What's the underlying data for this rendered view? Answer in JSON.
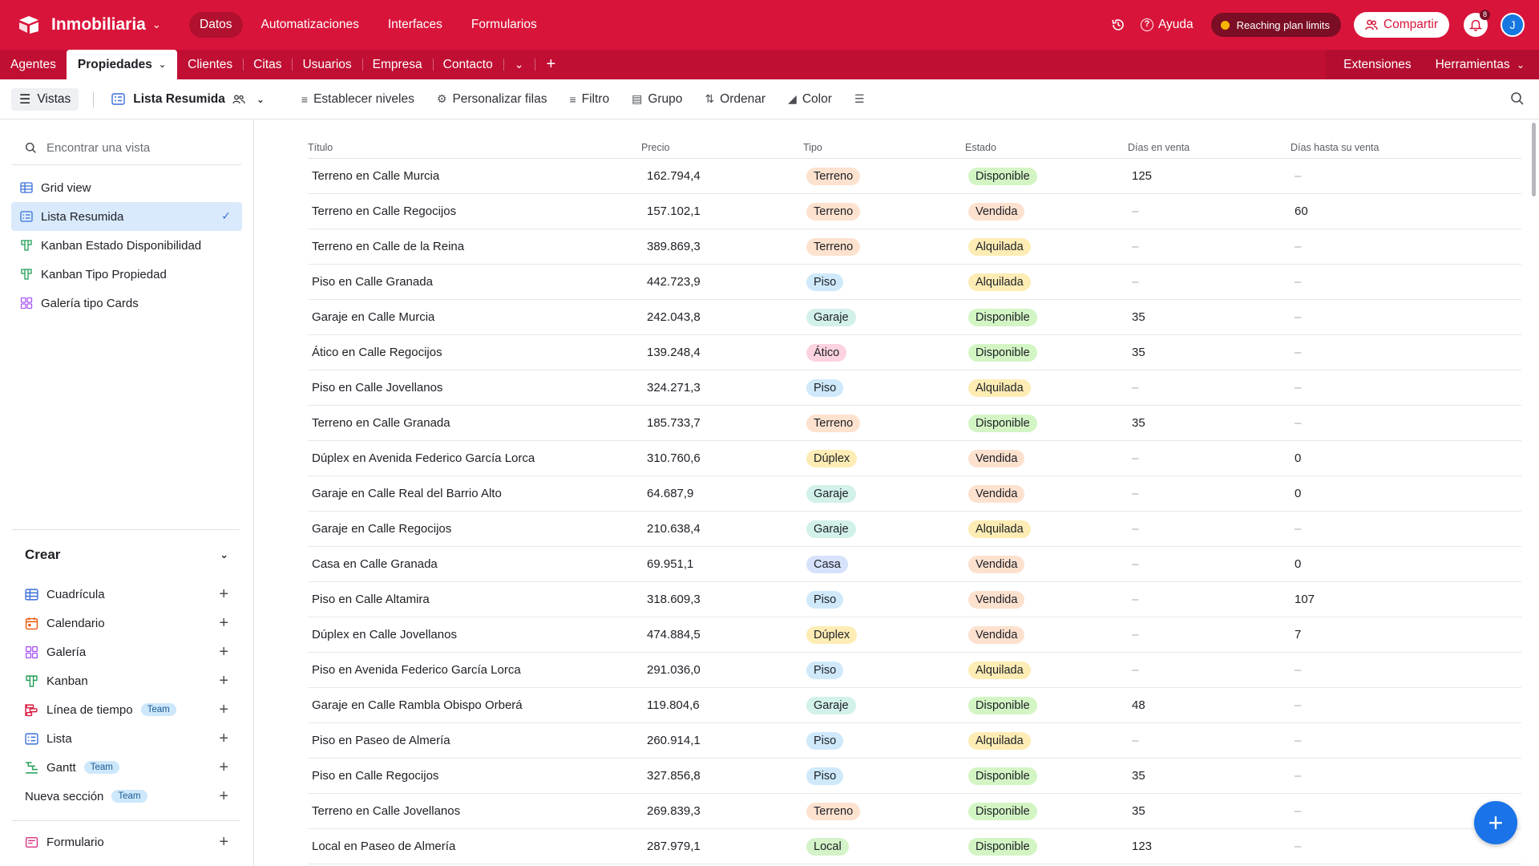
{
  "app": {
    "name": "Inmobiliaria",
    "nav": [
      "Datos",
      "Automatizaciones",
      "Interfaces",
      "Formularios"
    ],
    "help_label": "Ayuda",
    "plan_label": "Reaching plan limits",
    "share_label": "Compartir",
    "notifications_count": "8",
    "avatar_initial": "J"
  },
  "tables": {
    "tabs": [
      "Agentes",
      "Propiedades",
      "Clientes",
      "Citas",
      "Usuarios",
      "Empresa",
      "Contacto"
    ],
    "active": "Propiedades",
    "extensions_label": "Extensiones",
    "tools_label": "Herramientas"
  },
  "toolbar": {
    "views_label": "Vistas",
    "current_view": "Lista Resumida",
    "items": [
      "Establecer niveles",
      "Personalizar filas",
      "Filtro",
      "Grupo",
      "Ordenar",
      "Color"
    ]
  },
  "sidebar": {
    "find_placeholder": "Encontrar una vista",
    "views": [
      {
        "label": "Grid view",
        "icon": "grid-icon",
        "color": "#3a6fd9"
      },
      {
        "label": "Lista Resumida",
        "icon": "list-icon",
        "color": "#3a6fd9"
      },
      {
        "label": "Kanban Estado Disponibilidad",
        "icon": "kanban-icon",
        "color": "#1f9d55"
      },
      {
        "label": "Kanban Tipo Propiedad",
        "icon": "kanban-icon",
        "color": "#1f9d55"
      },
      {
        "label": "Galería tipo Cards",
        "icon": "gallery-icon",
        "color": "#a855f7"
      }
    ],
    "create_label": "Crear",
    "create_items": [
      {
        "label": "Cuadrícula",
        "icon": "grid-icon",
        "team": ""
      },
      {
        "label": "Calendario",
        "icon": "calendar-icon",
        "team": ""
      },
      {
        "label": "Galería",
        "icon": "gallery-icon",
        "team": ""
      },
      {
        "label": "Kanban",
        "icon": "kanban-icon",
        "team": ""
      },
      {
        "label": "Línea de tiempo",
        "icon": "timeline-icon",
        "team": "Team"
      },
      {
        "label": "Lista",
        "icon": "list-icon",
        "team": ""
      },
      {
        "label": "Gantt",
        "icon": "gantt-icon",
        "team": "Team"
      }
    ],
    "new_section_label": "Nueva sección",
    "new_section_team": "Team",
    "form_label": "Formulario"
  },
  "table": {
    "columns": [
      "Título",
      "Precio",
      "Tipo",
      "Estado",
      "Días en venta",
      "Días hasta su venta"
    ],
    "rows": [
      [
        "Terreno en Calle Murcia",
        "162.794,4",
        "Terreno",
        "Disponible",
        "125",
        "–"
      ],
      [
        "Terreno en Calle Regocijos",
        "157.102,1",
        "Terreno",
        "Vendida",
        "–",
        "60"
      ],
      [
        "Terreno en Calle de la Reina",
        "389.869,3",
        "Terreno",
        "Alquilada",
        "–",
        "–"
      ],
      [
        "Piso en Calle Granada",
        "442.723,9",
        "Piso",
        "Alquilada",
        "–",
        "–"
      ],
      [
        "Garaje en Calle Murcia",
        "242.043,8",
        "Garaje",
        "Disponible",
        "35",
        "–"
      ],
      [
        "Ático en Calle Regocijos",
        "139.248,4",
        "Ático",
        "Disponible",
        "35",
        "–"
      ],
      [
        "Piso en Calle Jovellanos",
        "324.271,3",
        "Piso",
        "Alquilada",
        "–",
        "–"
      ],
      [
        "Terreno en Calle Granada",
        "185.733,7",
        "Terreno",
        "Disponible",
        "35",
        "–"
      ],
      [
        "Dúplex en Avenida Federico García Lorca",
        "310.760,6",
        "Dúplex",
        "Vendida",
        "–",
        "0"
      ],
      [
        "Garaje en Calle Real del Barrio Alto",
        "64.687,9",
        "Garaje",
        "Vendida",
        "–",
        "0"
      ],
      [
        "Garaje en Calle Regocijos",
        "210.638,4",
        "Garaje",
        "Alquilada",
        "–",
        "–"
      ],
      [
        "Casa en Calle Granada",
        "69.951,1",
        "Casa",
        "Vendida",
        "–",
        "0"
      ],
      [
        "Piso en Calle Altamira",
        "318.609,3",
        "Piso",
        "Vendida",
        "–",
        "107"
      ],
      [
        "Dúplex en Calle Jovellanos",
        "474.884,5",
        "Dúplex",
        "Vendida",
        "–",
        "7"
      ],
      [
        "Piso en Avenida Federico García Lorca",
        "291.036,0",
        "Piso",
        "Alquilada",
        "–",
        "–"
      ],
      [
        "Garaje en Calle Rambla Obispo Orberá",
        "119.804,6",
        "Garaje",
        "Disponible",
        "48",
        "–"
      ],
      [
        "Piso en Paseo de Almería",
        "260.914,1",
        "Piso",
        "Alquilada",
        "–",
        "–"
      ],
      [
        "Piso en Calle Regocijos",
        "327.856,8",
        "Piso",
        "Disponible",
        "35",
        "–"
      ],
      [
        "Terreno en Calle Jovellanos",
        "269.839,3",
        "Terreno",
        "Disponible",
        "35",
        "–"
      ],
      [
        "Local en Paseo de Almería",
        "287.979,1",
        "Local",
        "Disponible",
        "123",
        "–"
      ]
    ]
  },
  "colors": {
    "brand": "#d9143a",
    "tipo": {
      "Terreno": "#fde2cf",
      "Piso": "#cfe9fb",
      "Garaje": "#d2f1ea",
      "Ático": "#fcd3df",
      "Dúplex": "#fdecb4",
      "Casa": "#d6e2fb",
      "Local": "#d4f3c8"
    },
    "estado": {
      "Disponible": "#d3f5c4",
      "Vendida": "#fde1cf",
      "Alquilada": "#fdecb4"
    }
  }
}
